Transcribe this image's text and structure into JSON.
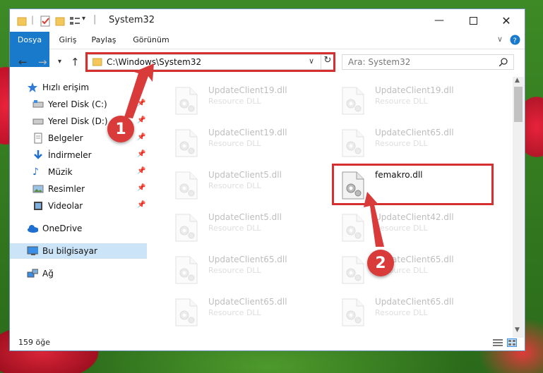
{
  "window": {
    "title": "System32"
  },
  "ribbon": {
    "tabs": [
      "Dosya",
      "Giriş",
      "Paylaş",
      "Görünüm"
    ]
  },
  "nav": {
    "address": "C:\\Windows\\System32",
    "search_placeholder": "Ara: System32"
  },
  "sidebar": {
    "items": [
      {
        "label": "Hızlı erişim",
        "icon": "star-icon"
      },
      {
        "label": "Yerel Disk (C:)",
        "icon": "drive-icon",
        "pinned": true
      },
      {
        "label": "Yerel Disk (D:)",
        "icon": "drive-icon",
        "pinned": true
      },
      {
        "label": "Belgeler",
        "icon": "documents-icon",
        "pinned": true
      },
      {
        "label": "İndirmeler",
        "icon": "download-icon",
        "pinned": true
      },
      {
        "label": "Müzik",
        "icon": "music-icon",
        "pinned": true
      },
      {
        "label": "Resimler",
        "icon": "pictures-icon",
        "pinned": true
      },
      {
        "label": "Videolar",
        "icon": "video-icon",
        "pinned": true
      },
      {
        "label": "OneDrive",
        "icon": "cloud-icon"
      },
      {
        "label": "Bu bilgisayar",
        "icon": "computer-icon"
      },
      {
        "label": "Ağ",
        "icon": "network-icon"
      }
    ]
  },
  "files": {
    "left": [
      {
        "name": "UpdateClient19.dll",
        "type": "Resource DLL"
      },
      {
        "name": "UpdateClient19.dll",
        "type": "Resource DLL"
      },
      {
        "name": "UpdateClient5.dll",
        "type": "Resource DLL"
      },
      {
        "name": "UpdateClient5.dll",
        "type": "Resource DLL"
      },
      {
        "name": "UpdateClient65.dll",
        "type": "Resource DLL"
      },
      {
        "name": "UpdateClient65.dll",
        "type": "Resource DLL"
      }
    ],
    "right": [
      {
        "name": "UpdateClient19.dll",
        "type": "Resource DLL"
      },
      {
        "name": "UpdateClient65.dll",
        "type": "Resource DLL"
      },
      {
        "name": "femakro.dll",
        "type": ""
      },
      {
        "name": "UpdateClient42.dll",
        "type": "Resource DLL"
      },
      {
        "name": "UpdateClient65.dll",
        "type": "Resource DLL"
      },
      {
        "name": "UpdateClient65.dll",
        "type": "Resource DLL"
      }
    ]
  },
  "status": {
    "count": "159 öğe"
  },
  "annotations": {
    "step1": "1",
    "step2": "2"
  },
  "colors": {
    "accent": "#1979ca",
    "highlight": "#d62f2f"
  }
}
